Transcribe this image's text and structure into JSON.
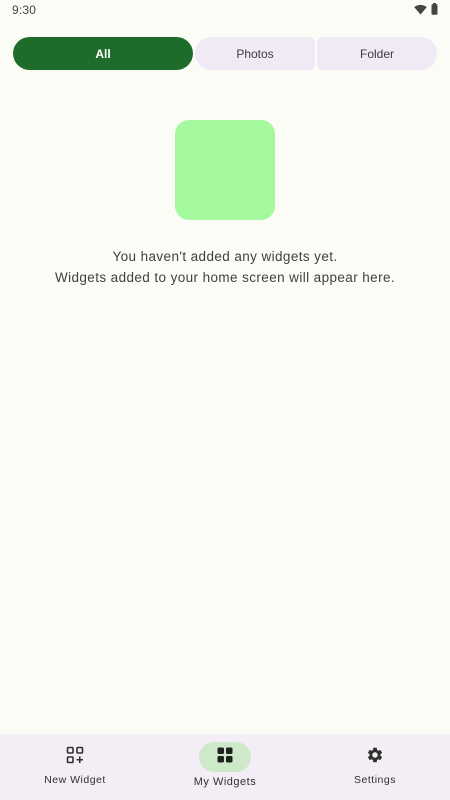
{
  "status_bar": {
    "time": "9:30",
    "icons": [
      "wifi-icon",
      "battery-icon"
    ]
  },
  "tabs": [
    {
      "label": "All",
      "selected": true
    },
    {
      "label": "Photos",
      "selected": false
    },
    {
      "label": "Folder",
      "selected": false
    }
  ],
  "empty_state": {
    "line1": "You haven't added any widgets yet.",
    "line2": "Widgets added to your home screen will appear here.",
    "illustration_color": "#a4f99e"
  },
  "bottom_nav": {
    "items": [
      {
        "label": "New Widget",
        "icon": "add-widget-icon",
        "selected": false
      },
      {
        "label": "My Widgets",
        "icon": "widgets-grid-icon",
        "selected": true
      },
      {
        "label": "Settings",
        "icon": "gear-icon",
        "selected": false
      }
    ]
  },
  "colors": {
    "background": "#fbfcf5",
    "accent": "#1e6c2a",
    "tab_inactive": "#efeaf5",
    "nav_background": "#f3eef6",
    "nav_active_indicator": "#cde9c9"
  }
}
